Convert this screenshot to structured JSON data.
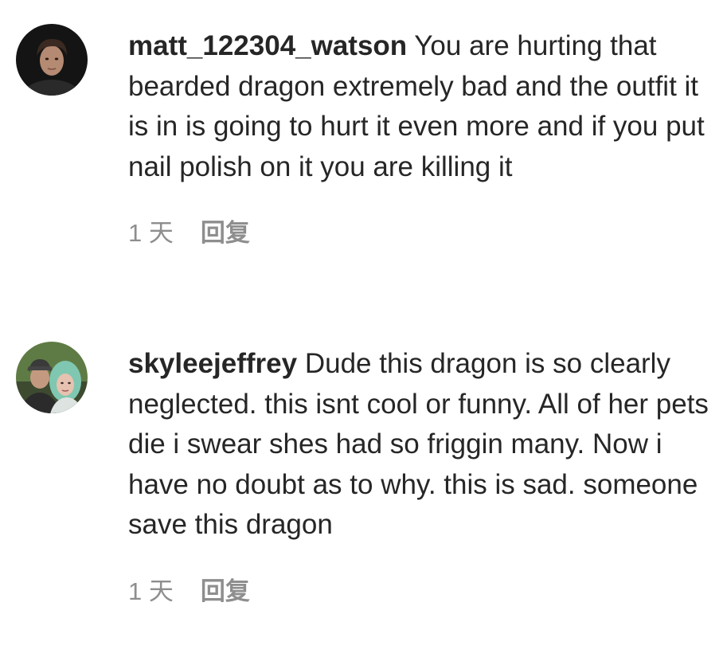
{
  "comments": [
    {
      "username": "matt_122304_watson",
      "text": "You are hurting that bearded dragon extremely bad and the outfit it is in is going to hurt it even more and if you put nail polish on it you are killing it",
      "time": "1 天",
      "reply_label": "回复"
    },
    {
      "username": "skyleejeffrey",
      "text": "Dude this dragon is so clearly neglected. this isnt cool or funny. All of her pets die i swear shes had so friggin many. Now i have no doubt as to why. this is sad. someone save this dragon",
      "time": "1 天",
      "reply_label": "回复"
    }
  ]
}
